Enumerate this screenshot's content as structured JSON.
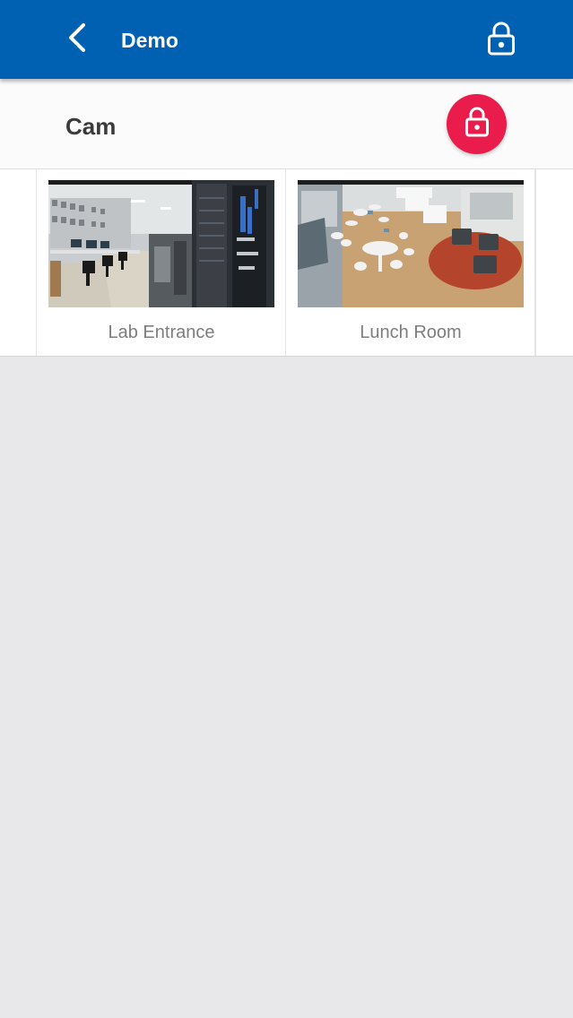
{
  "app_bar": {
    "title": "Demo",
    "background_color": "#0061b3",
    "back_icon": "chevron-left-icon",
    "lock_icon": "lock-icon"
  },
  "section": {
    "title": "Cam",
    "lock_fab_color": "#ea1c4b",
    "lock_fab_icon": "lock-icon"
  },
  "cameras": [
    {
      "label": "Lab Entrance"
    },
    {
      "label": "Lunch Room"
    }
  ],
  "colors": {
    "page_background": "#e8e7e9",
    "label_text": "#7d7d7d"
  }
}
